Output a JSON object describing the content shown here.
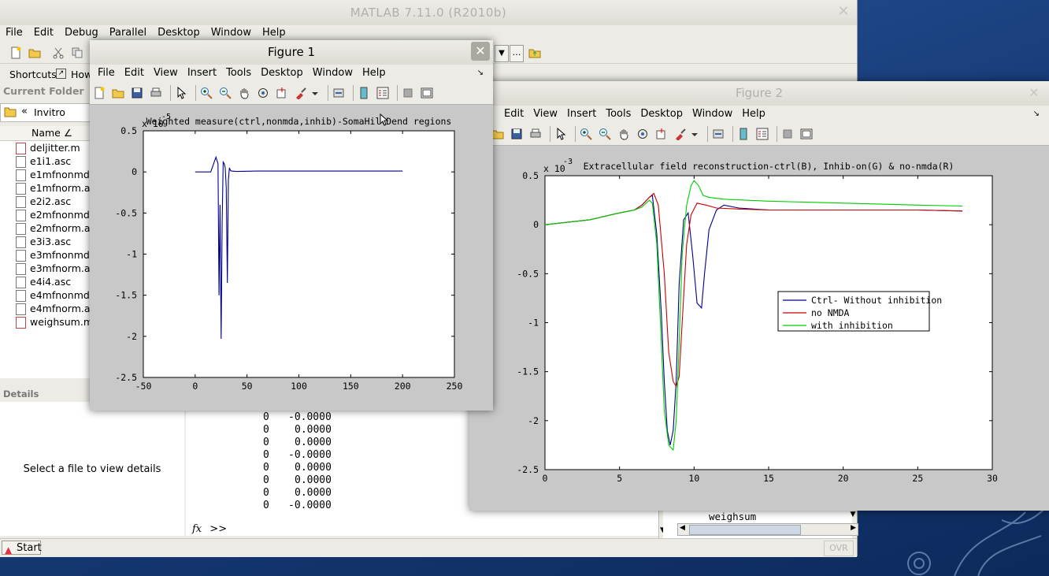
{
  "main": {
    "title": "MATLAB  7.11.0 (R2010b)",
    "menu": [
      "File",
      "Edit",
      "Debug",
      "Parallel",
      "Desktop",
      "Window",
      "Help"
    ],
    "shortcuts_label": "Shortcuts",
    "how_label": "How",
    "current_folder_title": "Current Folder",
    "folder_path": "Invitro",
    "name_header": "Name ∠",
    "files": [
      "deljitter.m",
      "e1i1.asc",
      "e1mfnonmd",
      "e1mfnorm.a",
      "e2i2.asc",
      "e2mfnonmd",
      "e2mfnorm.a",
      "e3i3.asc",
      "e3mfnonmd",
      "e3mfnorm.a",
      "e4i4.asc",
      "e4mfnonmd",
      "e4mfnorm.a",
      "weighsum.m"
    ],
    "details_title": "Details",
    "details_msg": "Select a file to view details",
    "cmd_rows": [
      [
        "0",
        "-0.0000"
      ],
      [
        "0",
        "0.0000"
      ],
      [
        "0",
        "0.0000"
      ],
      [
        "0",
        "-0.0000"
      ],
      [
        "0",
        "0.0000"
      ],
      [
        "0",
        "0.0000"
      ],
      [
        "0",
        "0.0000"
      ],
      [
        "0",
        "-0.0000"
      ]
    ],
    "fx": "fx",
    "prompt": ">>",
    "workspace_item": "weighsum",
    "start": "Start",
    "ovr": "OVR"
  },
  "fig1": {
    "title": "Figure 1",
    "menu": [
      "File",
      "Edit",
      "View",
      "Insert",
      "Tools",
      "Desktop",
      "Window",
      "Help"
    ],
    "chart_title": "Weighted measure(ctrl,nonmda,inhib)-SomaHillDend regions",
    "exp_label": "x 10",
    "exp_power": "-5",
    "xticks": [
      "-50",
      "0",
      "50",
      "100",
      "150",
      "200",
      "250"
    ],
    "yticks": [
      "0.5",
      "0",
      "-0.5",
      "-1",
      "-1.5",
      "-2",
      "-2.5"
    ]
  },
  "fig2": {
    "title": "Figure 2",
    "menu": [
      "Edit",
      "View",
      "Insert",
      "Tools",
      "Desktop",
      "Window",
      "Help"
    ],
    "chart_title": "Extracellular field reconstruction-ctrl(B), Inhib-on(G) & no-nmda(R)",
    "exp_label": "x 10",
    "exp_power": "-3",
    "xticks": [
      "0",
      "5",
      "10",
      "15",
      "20",
      "25",
      "30"
    ],
    "yticks": [
      "0.5",
      "0",
      "-0.5",
      "-1",
      "-1.5",
      "-2",
      "-2.5"
    ],
    "legend": [
      "Ctrl- Without inhibition",
      "no NMDA",
      "with inhibition"
    ]
  },
  "colors": {
    "blue": "#00008b",
    "red": "#cc0000",
    "green": "#00cc00"
  },
  "chart_data": [
    {
      "type": "line",
      "title": "Weighted measure(ctrl,nonmda,inhib)-SomaHillDend regions",
      "y_scale_label": "x 10^-5",
      "xlim": [
        -50,
        250
      ],
      "ylim": [
        -2.5,
        0.5
      ],
      "series": [
        {
          "color": "#00008b",
          "x": [
            0,
            15,
            20,
            22,
            23,
            24,
            25,
            26,
            27,
            28,
            29,
            30,
            31,
            32,
            33,
            34,
            35,
            40,
            60,
            100,
            150,
            200
          ],
          "y": [
            0,
            0,
            0.18,
            0.1,
            -1.5,
            -0.4,
            -2.03,
            -0.6,
            0.12,
            0.1,
            0.05,
            -0.2,
            -1.35,
            -0.1,
            0.05,
            0.02,
            0.01,
            0.005,
            0.01,
            0.01,
            0.01,
            0.01
          ]
        }
      ]
    },
    {
      "type": "line",
      "title": "Extracellular field reconstruction-ctrl(B), Inhib-on(G) & no-nmda(R)",
      "y_scale_label": "x 10^-3",
      "xlim": [
        0,
        30
      ],
      "ylim": [
        -2.5,
        0.5
      ],
      "legend_position": "center-right",
      "series": [
        {
          "name": "Ctrl- Without inhibition",
          "color": "#00008b",
          "x": [
            0,
            3,
            5,
            6,
            6.5,
            7,
            7.2,
            7.5,
            7.8,
            8,
            8.2,
            8.4,
            8.6,
            8.8,
            9,
            9.3,
            9.6,
            9.9,
            10.2,
            10.5,
            10.7,
            11,
            11.5,
            12,
            13,
            15,
            20,
            25,
            28
          ],
          "y": [
            0,
            0.05,
            0.12,
            0.15,
            0.2,
            0.28,
            0.3,
            -0.1,
            -0.9,
            -1.6,
            -2.1,
            -2.25,
            -2.1,
            -1.6,
            -0.6,
            0.05,
            0.12,
            -0.3,
            -0.8,
            -0.85,
            -0.5,
            -0.05,
            0.15,
            0.2,
            0.17,
            0.15,
            0.15,
            0.15,
            0.14
          ]
        },
        {
          "name": "no NMDA",
          "color": "#cc0000",
          "x": [
            0,
            3,
            5,
            6,
            6.5,
            7,
            7.3,
            7.6,
            8,
            8.3,
            8.6,
            8.8,
            9,
            9.2,
            9.5,
            9.8,
            10.2,
            10.8,
            11.5,
            13,
            15,
            20,
            25,
            28
          ],
          "y": [
            0,
            0.05,
            0.12,
            0.15,
            0.2,
            0.28,
            0.32,
            0.2,
            -0.5,
            -1.3,
            -1.6,
            -1.65,
            -1.55,
            -1.0,
            -0.2,
            0.1,
            0.22,
            0.2,
            0.17,
            0.16,
            0.15,
            0.15,
            0.15,
            0.14
          ]
        },
        {
          "name": "with inhibition",
          "color": "#00cc00",
          "x": [
            0,
            3,
            5,
            6,
            6.5,
            7,
            7.2,
            7.5,
            7.8,
            8,
            8.3,
            8.6,
            8.8,
            9,
            9.2,
            9.5,
            9.8,
            10,
            10.3,
            10.6,
            11,
            12,
            15,
            20,
            25,
            28
          ],
          "y": [
            0,
            0.05,
            0.12,
            0.15,
            0.18,
            0.25,
            0.22,
            -0.2,
            -1.2,
            -1.9,
            -2.25,
            -2.3,
            -2.0,
            -1.2,
            -0.3,
            0.2,
            0.4,
            0.45,
            0.4,
            0.3,
            0.28,
            0.26,
            0.24,
            0.22,
            0.2,
            0.19
          ]
        }
      ]
    }
  ]
}
